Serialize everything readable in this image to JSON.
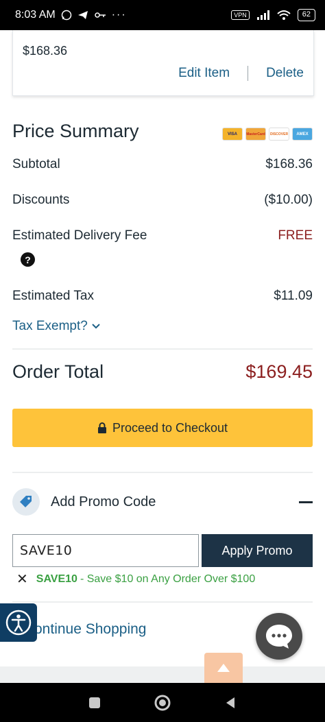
{
  "status_bar": {
    "time": "8:03 AM",
    "vpn": "VPN",
    "battery": "62"
  },
  "item": {
    "price": "$168.36",
    "edit_label": "Edit Item",
    "delete_label": "Delete"
  },
  "summary": {
    "title": "Price Summary",
    "cards": [
      "VISA",
      "MasterCard",
      "DISCOVER",
      "AMEX"
    ],
    "subtotal_label": "Subtotal",
    "subtotal_value": "$168.36",
    "discounts_label": "Discounts",
    "discounts_value": "($10.00)",
    "delivery_label": "Estimated Delivery Fee",
    "delivery_value": "FREE",
    "tax_label": "Estimated Tax",
    "tax_value": "$11.09",
    "tax_exempt_label": "Tax Exempt?",
    "order_total_label": "Order Total",
    "order_total_value": "$169.45"
  },
  "checkout": {
    "label": "Proceed to Checkout"
  },
  "promo": {
    "header_label": "Add Promo Code",
    "input_value": "SAVE10",
    "apply_label": "Apply Promo",
    "applied_code": "SAVE10",
    "applied_desc": "- Save $10 on Any Order Over $100"
  },
  "continue_label": "ontinue Shopping",
  "colors": {
    "accent_yellow": "#fec33a",
    "navy": "#1d3346",
    "link_blue": "#1b5f86",
    "total_red": "#8b1e1e",
    "promo_green": "#3aa042"
  }
}
